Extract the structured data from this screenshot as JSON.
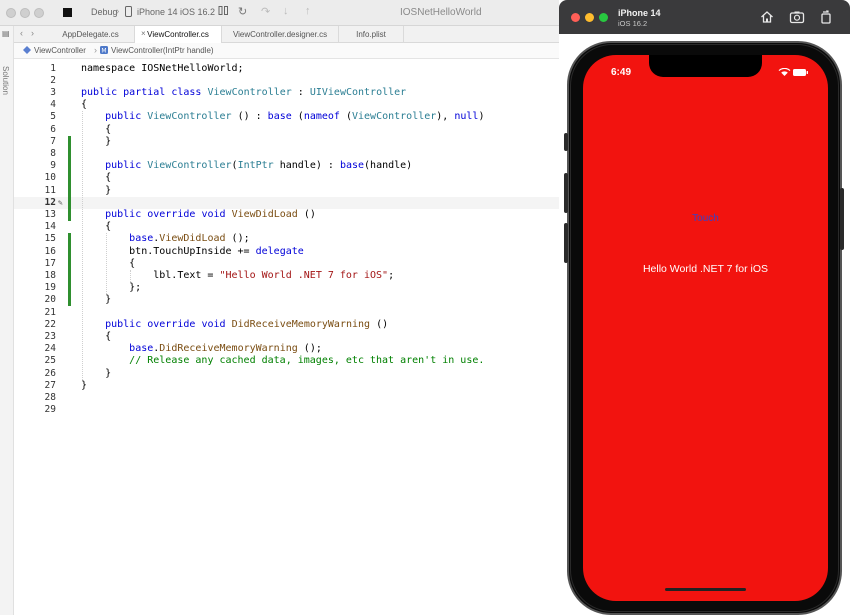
{
  "ide": {
    "toolbar": {
      "config": "Debug",
      "device": "iPhone 14 iOS 16.2",
      "window_title": "IOSNetHelloWorld"
    },
    "sidebar": {
      "label": "Solution"
    },
    "tabs": [
      {
        "label": "AppDelegate.cs",
        "active": false
      },
      {
        "label": "ViewController.cs",
        "active": true,
        "close_glyph": "×"
      },
      {
        "label": "ViewController.designer.cs",
        "active": false
      },
      {
        "label": "Info.plist",
        "active": false
      }
    ],
    "breadcrumb": {
      "items": [
        "ViewController",
        "ViewController(IntPtr handle)"
      ]
    },
    "current_line": 12,
    "changed_ranges": [
      [
        7,
        13
      ],
      [
        15,
        20
      ]
    ],
    "lines": [
      {
        "n": "1",
        "tokens": [
          [
            "",
            "namespace "
          ],
          [
            "",
            "IOSNetHelloWorld;"
          ]
        ]
      },
      {
        "n": "2",
        "tokens": []
      },
      {
        "n": "3",
        "tokens": [
          [
            "k",
            "public"
          ],
          [
            "",
            " "
          ],
          [
            "k",
            "partial"
          ],
          [
            "",
            " "
          ],
          [
            "k",
            "class"
          ],
          [
            "",
            " "
          ],
          [
            "t",
            "ViewController"
          ],
          [
            "",
            " : "
          ],
          [
            "t",
            "UIViewController"
          ]
        ]
      },
      {
        "n": "4",
        "tokens": [
          [
            "",
            "{"
          ]
        ]
      },
      {
        "n": "5",
        "tokens": [
          [
            "",
            "    "
          ],
          [
            "k",
            "public"
          ],
          [
            "",
            " "
          ],
          [
            "t",
            "ViewController"
          ],
          [
            "",
            " () : "
          ],
          [
            "k",
            "base"
          ],
          [
            "",
            " ("
          ],
          [
            "k",
            "nameof"
          ],
          [
            "",
            " ("
          ],
          [
            "t",
            "ViewController"
          ],
          [
            "",
            "), "
          ],
          [
            "k",
            "null"
          ],
          [
            "",
            ")"
          ]
        ]
      },
      {
        "n": "6",
        "tokens": [
          [
            "",
            "    {"
          ]
        ]
      },
      {
        "n": "7",
        "tokens": [
          [
            "",
            "    }"
          ]
        ]
      },
      {
        "n": "8",
        "tokens": []
      },
      {
        "n": "9",
        "tokens": [
          [
            "",
            "    "
          ],
          [
            "k",
            "public"
          ],
          [
            "",
            " "
          ],
          [
            "t",
            "ViewController"
          ],
          [
            "",
            "("
          ],
          [
            "t",
            "IntPtr"
          ],
          [
            "",
            " handle) : "
          ],
          [
            "k",
            "base"
          ],
          [
            "",
            "(handle)"
          ]
        ]
      },
      {
        "n": "10",
        "tokens": [
          [
            "",
            "    {"
          ]
        ]
      },
      {
        "n": "11",
        "tokens": [
          [
            "",
            "    }"
          ]
        ]
      },
      {
        "n": "12",
        "tokens": []
      },
      {
        "n": "13",
        "tokens": [
          [
            "",
            "    "
          ],
          [
            "k",
            "public"
          ],
          [
            "",
            " "
          ],
          [
            "k",
            "override"
          ],
          [
            "",
            " "
          ],
          [
            "k",
            "void"
          ],
          [
            "",
            " "
          ],
          [
            "m",
            "ViewDidLoad"
          ],
          [
            "",
            " ()"
          ]
        ]
      },
      {
        "n": "14",
        "tokens": [
          [
            "",
            "    {"
          ]
        ]
      },
      {
        "n": "15",
        "tokens": [
          [
            "",
            "        "
          ],
          [
            "k",
            "base"
          ],
          [
            "",
            "."
          ],
          [
            "m",
            "ViewDidLoad"
          ],
          [
            "",
            " ();"
          ]
        ]
      },
      {
        "n": "16",
        "tokens": [
          [
            "",
            "        btn.TouchUpInside += "
          ],
          [
            "k",
            "delegate"
          ]
        ]
      },
      {
        "n": "17",
        "tokens": [
          [
            "",
            "        {"
          ]
        ]
      },
      {
        "n": "18",
        "tokens": [
          [
            "",
            "            lbl.Text = "
          ],
          [
            "s",
            "\"Hello World .NET 7 for iOS\""
          ],
          [
            "",
            ";"
          ]
        ]
      },
      {
        "n": "19",
        "tokens": [
          [
            "",
            "        };"
          ]
        ]
      },
      {
        "n": "20",
        "tokens": [
          [
            "",
            "    }"
          ]
        ]
      },
      {
        "n": "21",
        "tokens": []
      },
      {
        "n": "22",
        "tokens": [
          [
            "",
            "    "
          ],
          [
            "k",
            "public"
          ],
          [
            "",
            " "
          ],
          [
            "k",
            "override"
          ],
          [
            "",
            " "
          ],
          [
            "k",
            "void"
          ],
          [
            "",
            " "
          ],
          [
            "m",
            "DidReceiveMemoryWarning"
          ],
          [
            "",
            " ()"
          ]
        ]
      },
      {
        "n": "23",
        "tokens": [
          [
            "",
            "    {"
          ]
        ]
      },
      {
        "n": "24",
        "tokens": [
          [
            "",
            "        "
          ],
          [
            "k",
            "base"
          ],
          [
            "",
            "."
          ],
          [
            "m",
            "DidReceiveMemoryWarning"
          ],
          [
            "",
            " ();"
          ]
        ]
      },
      {
        "n": "25",
        "tokens": [
          [
            "",
            "        "
          ],
          [
            "c",
            "// Release any cached data, images, etc that aren't in use."
          ]
        ]
      },
      {
        "n": "26",
        "tokens": [
          [
            "",
            "    }"
          ]
        ]
      },
      {
        "n": "27",
        "tokens": [
          [
            "",
            "}"
          ]
        ]
      },
      {
        "n": "28",
        "tokens": []
      },
      {
        "n": "29",
        "tokens": []
      }
    ]
  },
  "simulator": {
    "device_name": "iPhone 14",
    "os_version": "iOS 16.2",
    "status_time": "6:49",
    "screen_color": "#f2130f",
    "touch_button_label": "Touch",
    "hello_label": "Hello World .NET 7 for iOS"
  }
}
